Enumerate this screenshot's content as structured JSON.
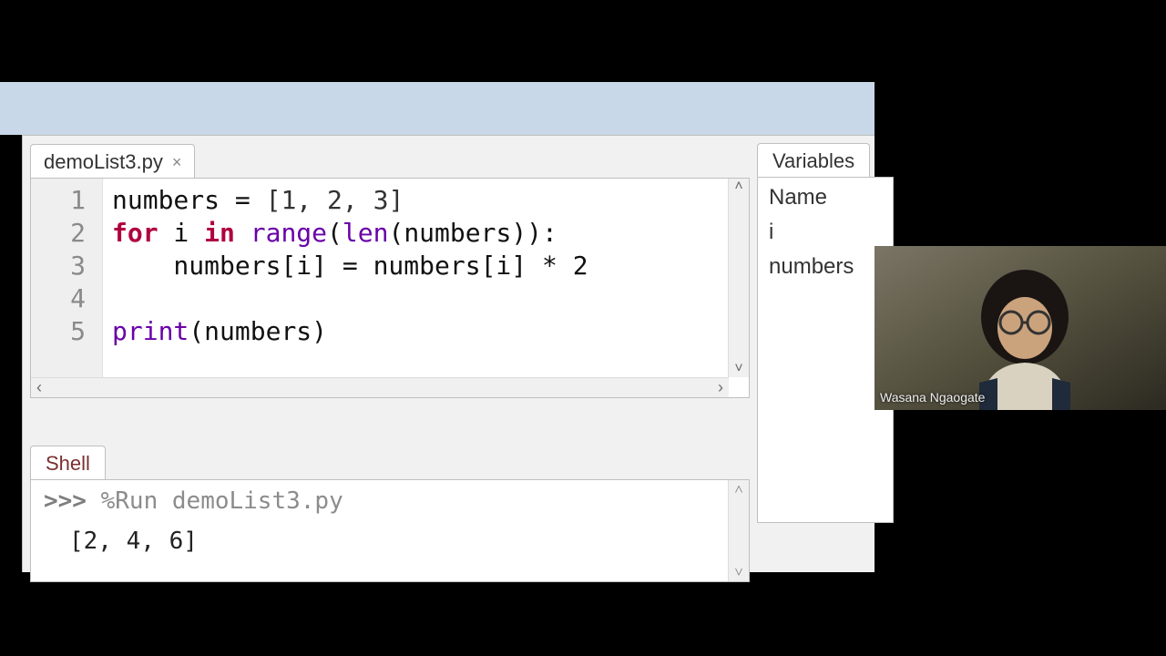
{
  "editor_tab": {
    "filename": "demoList3.py"
  },
  "code": {
    "line_numbers": [
      "1",
      "2",
      "3",
      "4",
      "5"
    ],
    "l1_var": "numbers",
    "l1_eq": " = ",
    "l1_list": "[1, 2, 3]",
    "l2_for": "for",
    "l2_i": " i ",
    "l2_in": "in",
    "l2_sp": " ",
    "l2_range": "range",
    "l2_open": "(",
    "l2_len": "len",
    "l2_arg": "(numbers)):",
    "l3_body": "    numbers[i] = numbers[i] * 2",
    "l4_body": "",
    "l5_print": "print",
    "l5_arg": "(numbers)"
  },
  "shell": {
    "tab_label": "Shell",
    "prompt": ">>>",
    "run_cmd": "%Run demoList3.py",
    "output": "[2, 4, 6]"
  },
  "variables": {
    "tab_label": "Variables",
    "header": "Name",
    "rows": [
      "i",
      "numbers"
    ]
  },
  "webcam": {
    "name": "Wasana Ngaogate"
  }
}
